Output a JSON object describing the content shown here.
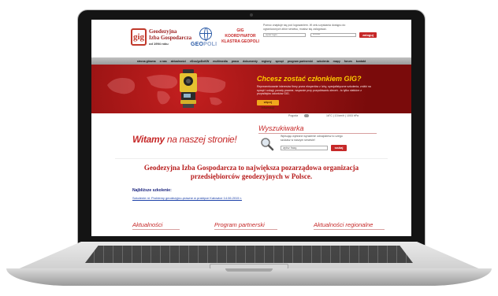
{
  "header": {
    "logo_mark": "gig",
    "logo_line1": "Geodezyjna",
    "logo_line2": "Izba Gospodarcza",
    "logo_line3": "od 1994 roku",
    "geopoli_prefix": "GEO",
    "geopoli_suffix": "POLI",
    "gig_line1": "GIG",
    "gig_line2": "KOORDYNATOR",
    "gig_line3": "KLASTRA GEOPOLI",
    "login_note": "Pomoc znajduje się pod logowaniem. W celu uzyskania dostępu do ograniczonych zbiór serwisu, musisz się zalogować.",
    "login_user": "wpisz login",
    "login_pass": "********",
    "login_button": "zaloguj"
  },
  "nav": {
    "items": [
      "strona główna",
      "o nas",
      "aktualności",
      "eDoc/goDoKW",
      "multimedia",
      "praca",
      "dokumenty",
      "regiony",
      "sprzęt",
      "program partnerski",
      "szkolenia",
      "mapy",
      "forum",
      "kontakt"
    ]
  },
  "banner": {
    "title": "Chcesz zostać członkiem GIG?",
    "description": "Reprezentowanie interesów firmy przez ekspertów z Izby, specjalistyczne szkolenia, zniżki na sprzęt i usługi, porady prawne, wsparcie przy pozyskiwaniu zleceń - to tylko niektóre z przywilejów członków GIG.",
    "button": "więcej informacji"
  },
  "weather": {
    "label": "Pogoda",
    "value": "16°C | 13 km/h | 1003 hPa"
  },
  "welcome": {
    "bold": "Witamy",
    "rest": " na naszej stronie!"
  },
  "search": {
    "heading": "Wyszukiwarka",
    "description": "Wpisując wybrane wyrażenie odnajdziesz to czego szukasz w naszym serwisie!",
    "placeholder": "wpisz frazę",
    "button": "szukaj"
  },
  "intro": "Geodezyjna Izba Gospodarcza to największa pozarządowa organizacja przedsiębiorców geodezyjnych w Polsce.",
  "training": {
    "heading": "Najbliższe szkolenie:",
    "link": "Szkolenie nt. Problemy geodezyjno-prawne w praktyce Katowice 14.06.2015 r."
  },
  "sections": [
    "Aktualności",
    "Program partnerski",
    "Aktualności regionalne"
  ],
  "colors": {
    "accent": "#c62828",
    "banner": "#a31414",
    "banner_title": "#ffcc00",
    "link": "#1a3fa8"
  }
}
